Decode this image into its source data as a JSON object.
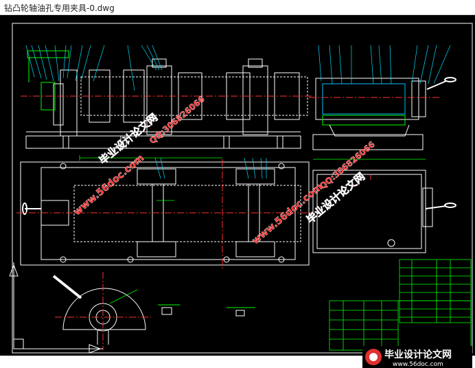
{
  "window": {
    "title": "钻凸轮轴油孔专用夹具-0.dwg"
  },
  "watermarks": {
    "site_cn": "毕业设计论文网",
    "site_url": "www.56doc.com",
    "qq": "QQ:306826066"
  },
  "logo": {
    "text": "毕业设计论文网",
    "url": "www.56doc.com"
  },
  "colors": {
    "background": "#000000",
    "frame": "#ffffff",
    "geometry": "#ffffff",
    "centerline": "#ff3030",
    "dimension": "#00ff00",
    "leader": "#00e0ff",
    "hatch": "#00c0ff",
    "watermark": "#ff2020",
    "titleblock": "#00ff00"
  }
}
